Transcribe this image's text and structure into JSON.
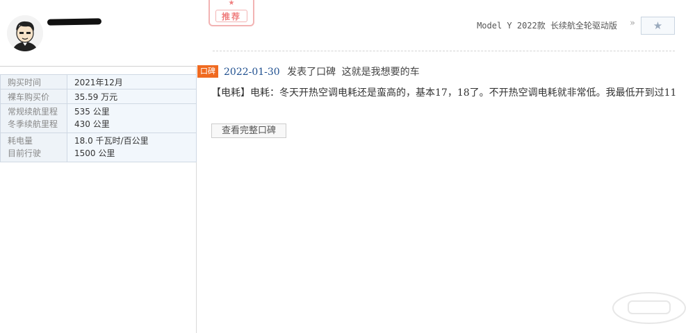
{
  "left": {
    "username": "████",
    "info": [
      {
        "keys": [
          "购买时间"
        ],
        "values": [
          "2021年12月"
        ]
      },
      {
        "keys": [
          "裸车购买价"
        ],
        "values": [
          "35.59 万元"
        ]
      },
      {
        "keys": [
          "常规续航里程",
          "冬季续航里程"
        ],
        "values": [
          "535 公里",
          "430 公里"
        ]
      },
      {
        "keys": [
          "耗电量",
          "目前行驶"
        ],
        "values": [
          "18.0 千瓦时/百公里",
          "1500 公里"
        ]
      }
    ]
  },
  "right": {
    "stamp_text": "推荐",
    "stamp_star": "★",
    "model_link": "Model Y 2022款 长续航全轮驱动版",
    "arrows": "»",
    "fav_icon": "★",
    "tag": "口碑",
    "post_date": "2022-01-30",
    "post_action": "发表了口碑",
    "post_title": "这就是我想要的车",
    "content_category": "【电耗】",
    "content_text": "电耗：冬天开热空调电耗还是蛮高的，基本17，18了。不开热空调电耗就非常低。我最低开到过11",
    "more_button": "查看完整口碑"
  },
  "colors": {
    "tag_bg": "#f06a20",
    "date_link": "#1f4f8f",
    "table_key_bg": "#eef3f8",
    "table_border": "#cfd8e3",
    "stamp": "#ef7e7e"
  }
}
